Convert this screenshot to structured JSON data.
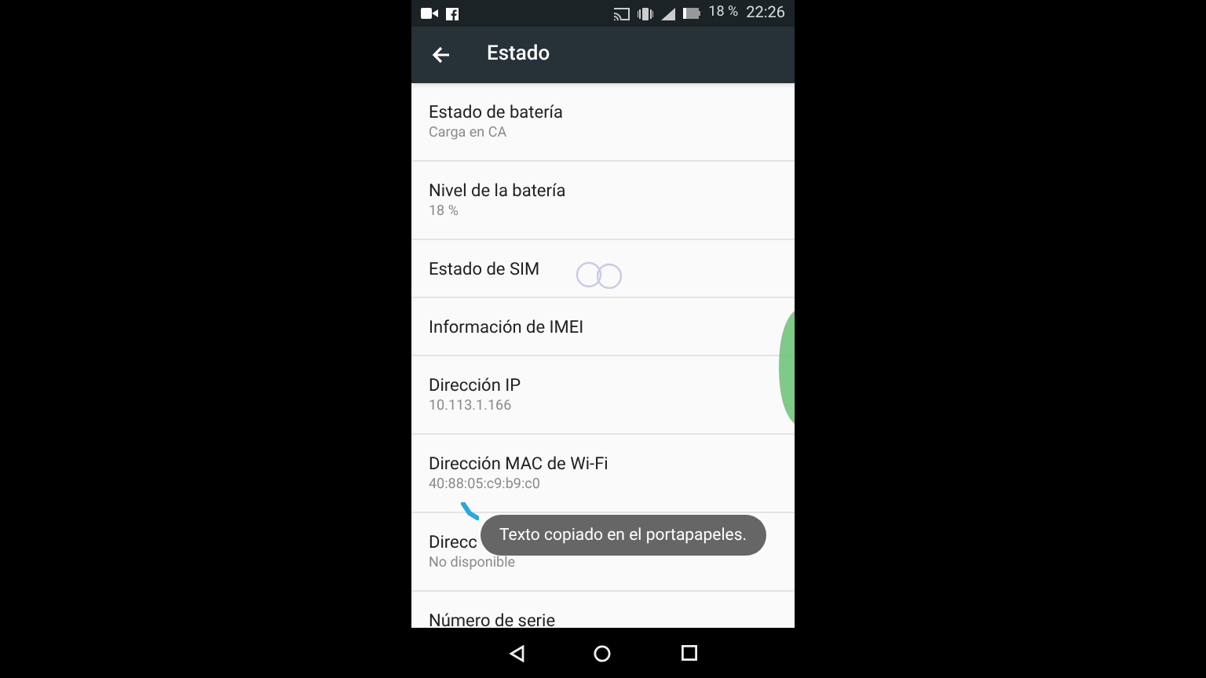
{
  "status_bar": {
    "battery": "18 %",
    "time": "22:26"
  },
  "toolbar": {
    "title": "Estado"
  },
  "items": [
    {
      "title": "Estado de batería",
      "summary": "Carga en CA"
    },
    {
      "title": "Nivel de la batería",
      "summary": "18 %"
    },
    {
      "title": "Estado de SIM"
    },
    {
      "title": "Información de IMEI"
    },
    {
      "title": "Dirección IP",
      "summary": "10.113.1.166"
    },
    {
      "title": "Dirección MAC de Wi-Fi",
      "summary": "40:88:05:c9:b9:c0"
    },
    {
      "title": "Direcc",
      "summary": "No disponible"
    },
    {
      "title": "Número de serie"
    }
  ],
  "toast": {
    "text": "Texto copiado en el portapapeles."
  }
}
